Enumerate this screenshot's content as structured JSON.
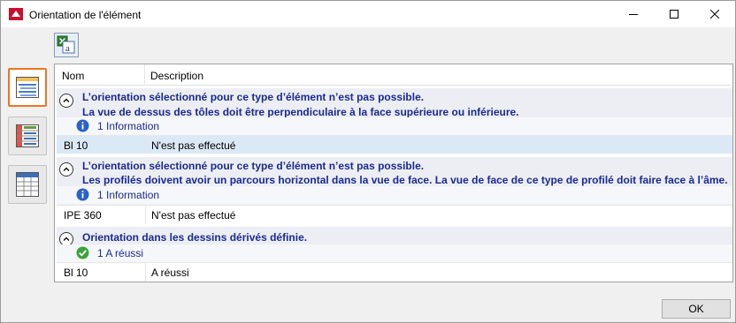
{
  "window": {
    "title": "Orientation de l'élément",
    "app_icon": "hicad-logo-icon",
    "controls": {
      "minimize": "minimize-icon",
      "maximize": "maximize-icon",
      "close": "close-icon"
    }
  },
  "toolbar": {
    "export_icon": "excel-export-icon"
  },
  "sidebar": {
    "buttons": [
      {
        "icon": "grouped-list-view-icon",
        "active": true
      },
      {
        "icon": "table-view-icon",
        "active": false
      },
      {
        "icon": "table-header-view-icon",
        "active": false
      }
    ]
  },
  "columns": {
    "nom": "Nom",
    "description": "Description"
  },
  "groups": [
    {
      "line1": "L’orientation sélectionné pour ce type d’élément n’est pas possible.",
      "line2": "La vue de dessus des tôles doit être perpendiculaire à la face supérieure ou inférieure.",
      "status_icon": "info-icon",
      "status_label": "1 Information",
      "row": {
        "nom": "Bl 10",
        "description": "N'est pas effectué"
      }
    },
    {
      "line1": "L’orientation sélectionné pour ce type d’élément n’est pas possible.",
      "line2": "Les profilés doivent avoir un parcours horizontal dans la vue de face. La vue de face de ce type de profilé doit faire face à l’âme.",
      "status_icon": "info-icon",
      "status_label": "1 Information",
      "row": {
        "nom": "IPE 360",
        "description": "N'est pas effectué"
      }
    },
    {
      "line1": "Orientation dans les dessins dérivés définie.",
      "status_icon": "success-check-icon",
      "status_label": "1 A réussi",
      "row": {
        "nom": "Bl 10",
        "description": "A réussi"
      }
    }
  ],
  "footer": {
    "ok_label": "OK"
  },
  "colors": {
    "accent": "#e87722",
    "message_text": "#1b2a8f",
    "selected_row": "#dbe8f5"
  }
}
